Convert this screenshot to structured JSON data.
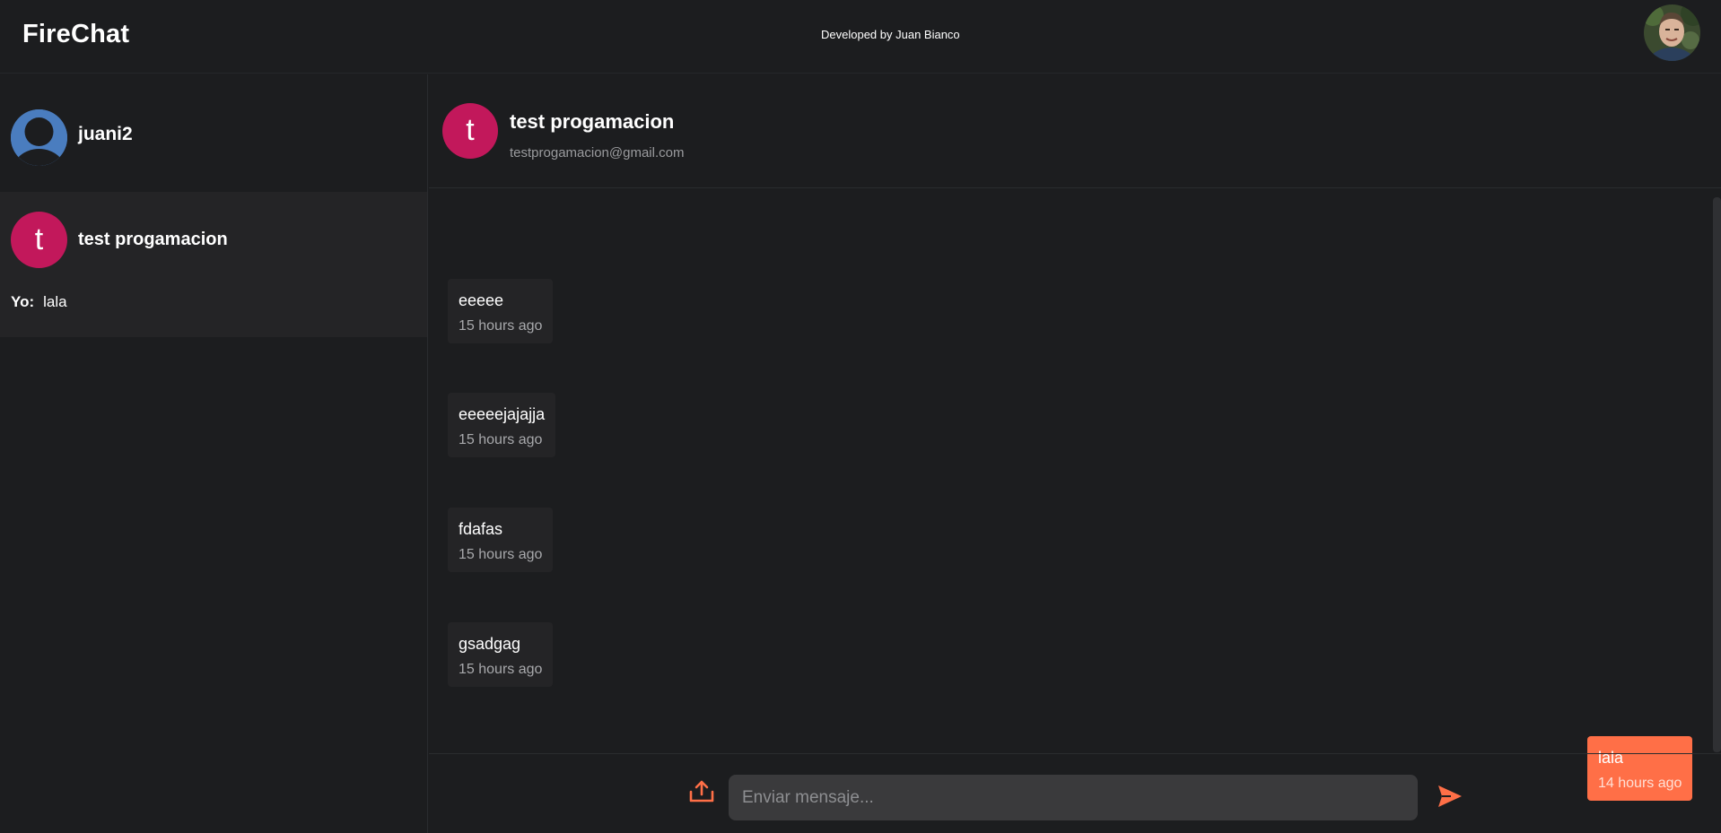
{
  "header": {
    "brand": "FireChat",
    "credit": "Developed by Juan Bianco",
    "avatar_icon": "user-photo-icon"
  },
  "sidebar": {
    "profile": {
      "name": "juani2",
      "avatar_icon": "default-user-icon"
    },
    "conversations": [
      {
        "initial": "t",
        "name": "test progamacion",
        "last_sender": "Yo:",
        "last_message": "lala"
      }
    ]
  },
  "chat": {
    "contact": {
      "initial": "t",
      "name": "test progamacion",
      "email": "testprogamacion@gmail.com"
    },
    "messages": [
      {
        "text": "eeeee",
        "time": "15 hours ago",
        "mine": false
      },
      {
        "text": "eeeeejajajja",
        "time": "15 hours ago",
        "mine": false
      },
      {
        "text": "fdafas",
        "time": "15 hours ago",
        "mine": false
      },
      {
        "text": "gsadgag",
        "time": "15 hours ago",
        "mine": false
      },
      {
        "text": "lala",
        "time": "14 hours ago",
        "mine": true
      }
    ]
  },
  "composer": {
    "placeholder": "Enviar mensaje...",
    "value": "",
    "upload_icon": "upload-icon",
    "send_icon": "send-icon"
  },
  "colors": {
    "background": "#1c1d1f",
    "accent": "#ff6f47",
    "avatar_pink": "#c2185b",
    "avatar_blue": "#4a7dbf",
    "bubble": "#242426"
  }
}
